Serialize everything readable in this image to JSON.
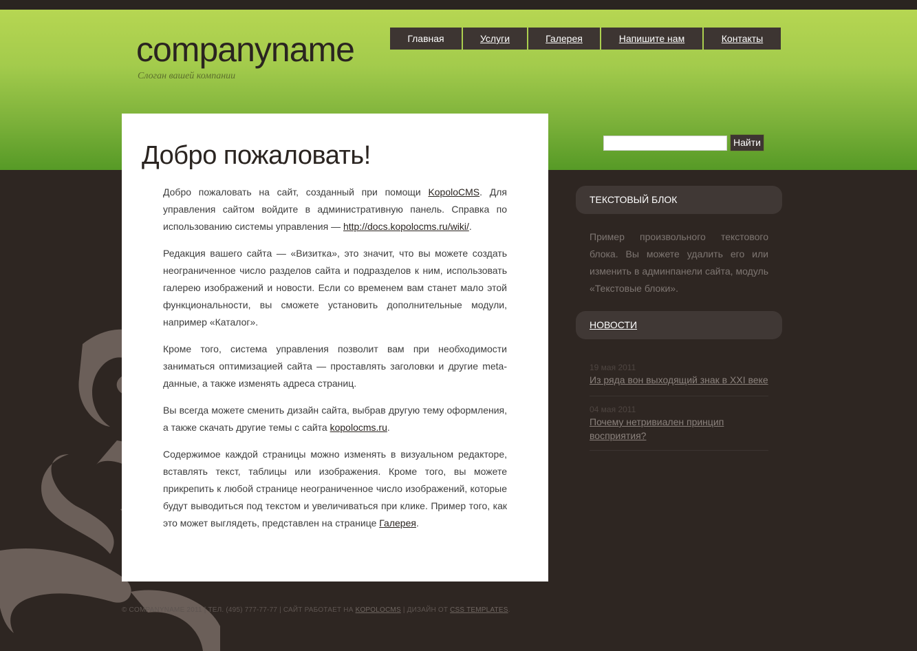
{
  "site": {
    "logo": "companyname",
    "slogan": "Слоган вашей компании"
  },
  "nav": [
    {
      "label": "Главная",
      "active": true
    },
    {
      "label": "Услуги"
    },
    {
      "label": "Галерея"
    },
    {
      "label": "Напишите нам"
    },
    {
      "label": "Контакты"
    }
  ],
  "search": {
    "placeholder": "",
    "button_label": "Найти"
  },
  "content": {
    "title": "Добро пожаловать!",
    "p1_a": "Добро пожаловать на сайт, созданный при помощи ",
    "p1_link1": "KopoloCMS",
    "p1_b": ". Для управления сайтом войдите в административную панель. Справка по использованию системы управления — ",
    "p1_link2": "http://docs.kopolocms.ru/wiki/",
    "p1_c": ".",
    "p2": "Редакция вашего сайта — «Визитка», это значит, что вы можете создать неограниченное число разделов сайта и подразделов к ним, использовать галерею изображений и новости. Если со временем вам станет мало этой функциональности, вы сможете установить дополнительные модули, например «Каталог».",
    "p3": "Кроме того, система управления позволит вам при необходимости заниматься оптимизацией сайта — проставлять заголовки и другие meta-данные, а также изменять адреса страниц.",
    "p4_a": "Вы всегда можете сменить дизайн сайта, выбрав другую тему оформления, а также скачать другие темы с сайта ",
    "p4_link": "kopolocms.ru",
    "p4_b": ".",
    "p5_a": "Содержимое каждой страницы можно изменять в визуальном редакторе, вставлять текст, таблицы или изображения. Кроме того, вы можете прикрепить к любой странице неограниченное число изображений, которые будут выводиться под текстом и увеличиваться при клике. Пример того, как это может выглядеть, представлен на странице ",
    "p5_link": "Галерея",
    "p5_b": "."
  },
  "sidebar": {
    "text_block": {
      "title": "ТЕКСТОВЫЙ БЛОК",
      "text": "Пример произвольного текстового блока. Вы можете удалить его или изменить в админпанели сайта, модуль «Текстовые блоки»."
    },
    "news": {
      "title": "НОВОСТИ",
      "items": [
        {
          "date": "19 мая 2011",
          "title": "Из ряда вон выходящий знак в XXI веке"
        },
        {
          "date": "04 мая 2011",
          "title": "Почему нетривиален принцип восприятия?"
        }
      ]
    }
  },
  "footer": {
    "text_a": "© COMPANYNAME 2011 | ТЕЛ. (495) 777-77-77 | САЙТ РАБОТАЕТ НА ",
    "link1": "KOPOLOCMS",
    "text_b": " | ДИЗАЙН ОТ ",
    "link2": "CSS TEMPLATES",
    "text_c": "."
  },
  "colors": {
    "header_green": "#8fc045",
    "dark_bg": "#2e2622",
    "nav_bg": "#3d3532",
    "swirl": "#6b5f59"
  }
}
